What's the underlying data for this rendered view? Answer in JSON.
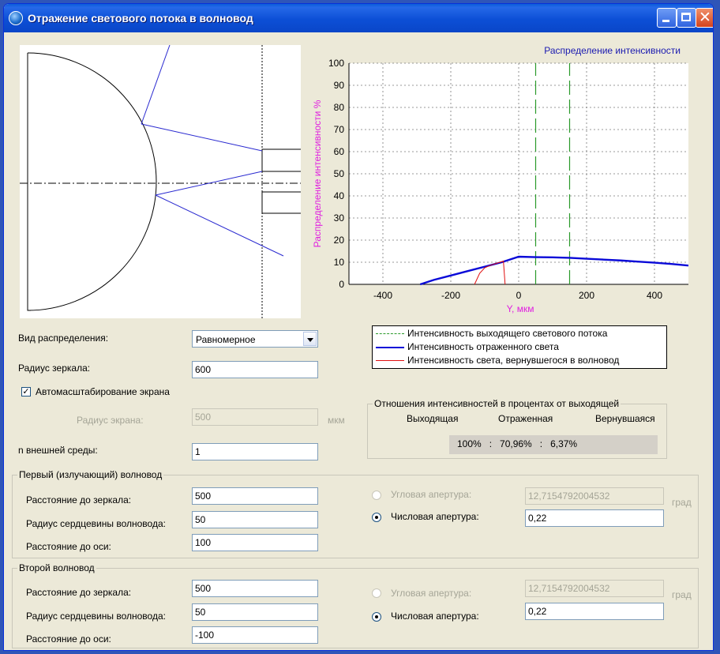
{
  "window": {
    "title": "Отражение светового потока в волновод",
    "icon": "app-globe-icon",
    "controls": [
      "minimize-icon",
      "maximize-icon",
      "close-icon"
    ]
  },
  "colors": {
    "titlebar": "#0a5ddb",
    "output_line": "#2a9a2a",
    "reflected_line": "#0a0ad8",
    "returned_line": "#e01010",
    "axis_label": "#e01ee0",
    "chart_title": "#1a1ab0",
    "waveguide_rays": "#2a2ad0"
  },
  "chart_data": {
    "type": "line",
    "title": "Распределение интенсивности",
    "xlabel": "Y, мкм",
    "ylabel": "Распределение интенсивности %",
    "xlim": [
      -500,
      500
    ],
    "ylim": [
      0,
      100
    ],
    "x_ticks": [
      "-400",
      "-200",
      "0",
      "200",
      "400"
    ],
    "y_ticks": [
      "0",
      "10",
      "20",
      "30",
      "40",
      "50",
      "60",
      "70",
      "80",
      "90",
      "100"
    ],
    "grid": true,
    "series": [
      {
        "name": "Интенсивность выходящего светового потока",
        "style": "dashed",
        "color": "#2a9a2a",
        "lines": [
          {
            "x": [
              50,
              50
            ],
            "y": [
              0,
              100
            ]
          },
          {
            "x": [
              150,
              150
            ],
            "y": [
              0,
              100
            ]
          }
        ]
      },
      {
        "name": "Интенсивность отраженного света",
        "style": "solid-thick",
        "color": "#0a0ad8",
        "x": [
          -290,
          -250,
          -200,
          -150,
          -100,
          -50,
          0,
          50,
          100,
          150,
          200,
          250,
          300,
          350,
          400,
          450,
          500
        ],
        "y": [
          0,
          2,
          4,
          6,
          8,
          10,
          12.5,
          12.3,
          12.2,
          12.0,
          11.6,
          11.2,
          10.8,
          10.3,
          9.8,
          9.2,
          8.5
        ]
      },
      {
        "name": "Интенсивность света, вернувшегося в волновод",
        "style": "solid",
        "color": "#e01010",
        "x": [
          -130,
          -115,
          -100,
          -85,
          -70,
          -55,
          -45,
          -40
        ],
        "y": [
          0,
          5,
          7.5,
          8.5,
          9.3,
          10,
          10.5,
          0
        ]
      }
    ]
  },
  "legend": [
    {
      "label": "Интенсивность выходящего светового потока"
    },
    {
      "label": "Интенсивность отраженного света"
    },
    {
      "label": "Интенсивность света, вернувшегося в волновод"
    }
  ],
  "form": {
    "distribution_label": "Вид распределения:",
    "distribution_value": "Равномерное",
    "mirror_radius_label": "Радиус зеркала:",
    "mirror_radius_value": "600",
    "autoscale_label": "Автомасштабирование экрана",
    "autoscale_checked": "✓",
    "screen_radius_label": "Радиус экрана:",
    "screen_radius_value": "500",
    "screen_radius_unit": "мкм",
    "n_label": "n внешней среды:",
    "n_value": "1"
  },
  "ratios": {
    "group_title": "Отношения интенсивностей в процентах от выходящей",
    "col_out": "Выходящая",
    "col_reflected": "Отраженная",
    "col_returned": "Вернувшаяся",
    "values_text": "100%   :   70,96%   :   6,37%"
  },
  "waveguide1": {
    "title": "Первый (излучающий) волновод",
    "dist_label": "Расстояние до зеркала:",
    "dist_value": "500",
    "core_label": "Радиус сердцевины волновода:",
    "core_value": "50",
    "axis_label": "Расстояние до оси:",
    "axis_value": "100",
    "ang_label": "Угловая апертура:",
    "ang_value": "12,7154792004532",
    "ang_unit": "град",
    "num_label": "Числовая апертура:",
    "num_value": "0,22"
  },
  "waveguide2": {
    "title": "Второй волновод",
    "dist_label": "Расстояние до зеркала:",
    "dist_value": "500",
    "core_label": "Радиус сердцевины волновода:",
    "core_value": "50",
    "axis_label": "Расстояние до оси:",
    "axis_value": "-100",
    "ang_label": "Угловая апертура:",
    "ang_value": "12,7154792004532",
    "ang_unit": "град",
    "num_label": "Числовая апертура:",
    "num_value": "0,22"
  }
}
